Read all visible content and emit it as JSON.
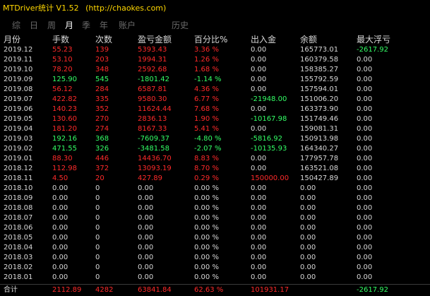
{
  "colors": {
    "positive": "#ff2a2a",
    "negative": "#33ff66",
    "neutral": "#d8d8d8",
    "title": "#ffd700",
    "background": "#000000"
  },
  "window": {
    "title": "MTDriver统计 V1.52",
    "subtitle": "(http://chaokes.com)"
  },
  "tabs": [
    {
      "label": "综",
      "active": false
    },
    {
      "label": "日",
      "active": false
    },
    {
      "label": "周",
      "active": false
    },
    {
      "label": "月",
      "active": true
    },
    {
      "label": "季",
      "active": false
    },
    {
      "label": "年",
      "active": false
    },
    {
      "label": "账户",
      "active": false
    },
    {
      "label": "历史",
      "active": false
    }
  ],
  "columns": [
    "月份",
    "手数",
    "次数",
    "盈亏金额",
    "百分比%",
    "出入金",
    "余额",
    "最大浮亏"
  ],
  "rows": [
    [
      "2019.12",
      "55.23",
      "139",
      "5393.43",
      "3.36 %",
      "0.00",
      "165773.01",
      "-2617.92"
    ],
    [
      "2019.11",
      "53.10",
      "203",
      "1994.31",
      "1.26 %",
      "0.00",
      "160379.58",
      "0.00"
    ],
    [
      "2019.10",
      "78.20",
      "348",
      "2592.68",
      "1.68 %",
      "0.00",
      "158385.27",
      "0.00"
    ],
    [
      "2019.09",
      "125.90",
      "545",
      "-1801.42",
      "-1.14 %",
      "0.00",
      "155792.59",
      "0.00"
    ],
    [
      "2019.08",
      "56.12",
      "284",
      "6587.81",
      "4.36 %",
      "0.00",
      "157594.01",
      "0.00"
    ],
    [
      "2019.07",
      "422.82",
      "335",
      "9580.30",
      "6.77 %",
      "-21948.00",
      "151006.20",
      "0.00"
    ],
    [
      "2019.06",
      "140.23",
      "352",
      "11624.44",
      "7.68 %",
      "0.00",
      "163373.90",
      "0.00"
    ],
    [
      "2019.05",
      "130.60",
      "270",
      "2836.13",
      "1.90 %",
      "-10167.98",
      "151749.46",
      "0.00"
    ],
    [
      "2019.04",
      "181.20",
      "274",
      "8167.33",
      "5.41 %",
      "0.00",
      "159081.31",
      "0.00"
    ],
    [
      "2019.03",
      "192.16",
      "368",
      "-7609.37",
      "-4.80 %",
      "-5816.92",
      "150913.98",
      "0.00"
    ],
    [
      "2019.02",
      "471.55",
      "326",
      "-3481.58",
      "-2.07 %",
      "-10135.93",
      "164340.27",
      "0.00"
    ],
    [
      "2019.01",
      "88.30",
      "446",
      "14436.70",
      "8.83 %",
      "0.00",
      "177957.78",
      "0.00"
    ],
    [
      "2018.12",
      "112.98",
      "372",
      "13093.19",
      "8.70 %",
      "0.00",
      "163521.08",
      "0.00"
    ],
    [
      "2018.11",
      "4.50",
      "20",
      "427.89",
      "0.29 %",
      "150000.00",
      "150427.89",
      "0.00"
    ],
    [
      "2018.10",
      "0.00",
      "0",
      "0.00",
      "0.00 %",
      "0.00",
      "0.00",
      "0.00"
    ],
    [
      "2018.09",
      "0.00",
      "0",
      "0.00",
      "0.00 %",
      "0.00",
      "0.00",
      "0.00"
    ],
    [
      "2018.08",
      "0.00",
      "0",
      "0.00",
      "0.00 %",
      "0.00",
      "0.00",
      "0.00"
    ],
    [
      "2018.07",
      "0.00",
      "0",
      "0.00",
      "0.00 %",
      "0.00",
      "0.00",
      "0.00"
    ],
    [
      "2018.06",
      "0.00",
      "0",
      "0.00",
      "0.00 %",
      "0.00",
      "0.00",
      "0.00"
    ],
    [
      "2018.05",
      "0.00",
      "0",
      "0.00",
      "0.00 %",
      "0.00",
      "0.00",
      "0.00"
    ],
    [
      "2018.04",
      "0.00",
      "0",
      "0.00",
      "0.00 %",
      "0.00",
      "0.00",
      "0.00"
    ],
    [
      "2018.03",
      "0.00",
      "0",
      "0.00",
      "0.00 %",
      "0.00",
      "0.00",
      "0.00"
    ],
    [
      "2018.02",
      "0.00",
      "0",
      "0.00",
      "0.00 %",
      "0.00",
      "0.00",
      "0.00"
    ],
    [
      "2018.01",
      "0.00",
      "0",
      "0.00",
      "0.00 %",
      "0.00",
      "0.00",
      "0.00"
    ]
  ],
  "row_colors": [
    [
      "white",
      "red",
      "red",
      "red",
      "red",
      "white",
      "white",
      "green"
    ],
    [
      "white",
      "red",
      "red",
      "red",
      "red",
      "white",
      "white",
      "white"
    ],
    [
      "white",
      "red",
      "red",
      "red",
      "red",
      "white",
      "white",
      "white"
    ],
    [
      "white",
      "green",
      "green",
      "green",
      "green",
      "white",
      "white",
      "white"
    ],
    [
      "white",
      "red",
      "red",
      "red",
      "red",
      "white",
      "white",
      "white"
    ],
    [
      "white",
      "red",
      "red",
      "red",
      "red",
      "green",
      "white",
      "white"
    ],
    [
      "white",
      "red",
      "red",
      "red",
      "red",
      "white",
      "white",
      "white"
    ],
    [
      "white",
      "red",
      "red",
      "red",
      "red",
      "green",
      "white",
      "white"
    ],
    [
      "white",
      "red",
      "red",
      "red",
      "red",
      "white",
      "white",
      "white"
    ],
    [
      "white",
      "green",
      "green",
      "green",
      "green",
      "green",
      "white",
      "white"
    ],
    [
      "white",
      "green",
      "green",
      "green",
      "green",
      "green",
      "white",
      "white"
    ],
    [
      "white",
      "red",
      "red",
      "red",
      "red",
      "white",
      "white",
      "white"
    ],
    [
      "white",
      "red",
      "red",
      "red",
      "red",
      "white",
      "white",
      "white"
    ],
    [
      "white",
      "red",
      "red",
      "red",
      "red",
      "red",
      "white",
      "white"
    ],
    [
      "white",
      "white",
      "white",
      "white",
      "white",
      "white",
      "white",
      "white"
    ],
    [
      "white",
      "white",
      "white",
      "white",
      "white",
      "white",
      "white",
      "white"
    ],
    [
      "white",
      "white",
      "white",
      "white",
      "white",
      "white",
      "white",
      "white"
    ],
    [
      "white",
      "white",
      "white",
      "white",
      "white",
      "white",
      "white",
      "white"
    ],
    [
      "white",
      "white",
      "white",
      "white",
      "white",
      "white",
      "white",
      "white"
    ],
    [
      "white",
      "white",
      "white",
      "white",
      "white",
      "white",
      "white",
      "white"
    ],
    [
      "white",
      "white",
      "white",
      "white",
      "white",
      "white",
      "white",
      "white"
    ],
    [
      "white",
      "white",
      "white",
      "white",
      "white",
      "white",
      "white",
      "white"
    ],
    [
      "white",
      "white",
      "white",
      "white",
      "white",
      "white",
      "white",
      "white"
    ],
    [
      "white",
      "white",
      "white",
      "white",
      "white",
      "white",
      "white",
      "white"
    ]
  ],
  "totals": [
    "合计",
    "2112.89",
    "4282",
    "63841.84",
    "62.63 %",
    "101931.17",
    "",
    "-2617.92"
  ],
  "totals_colors": [
    "white",
    "red",
    "red",
    "red",
    "red",
    "red",
    "white",
    "green"
  ]
}
